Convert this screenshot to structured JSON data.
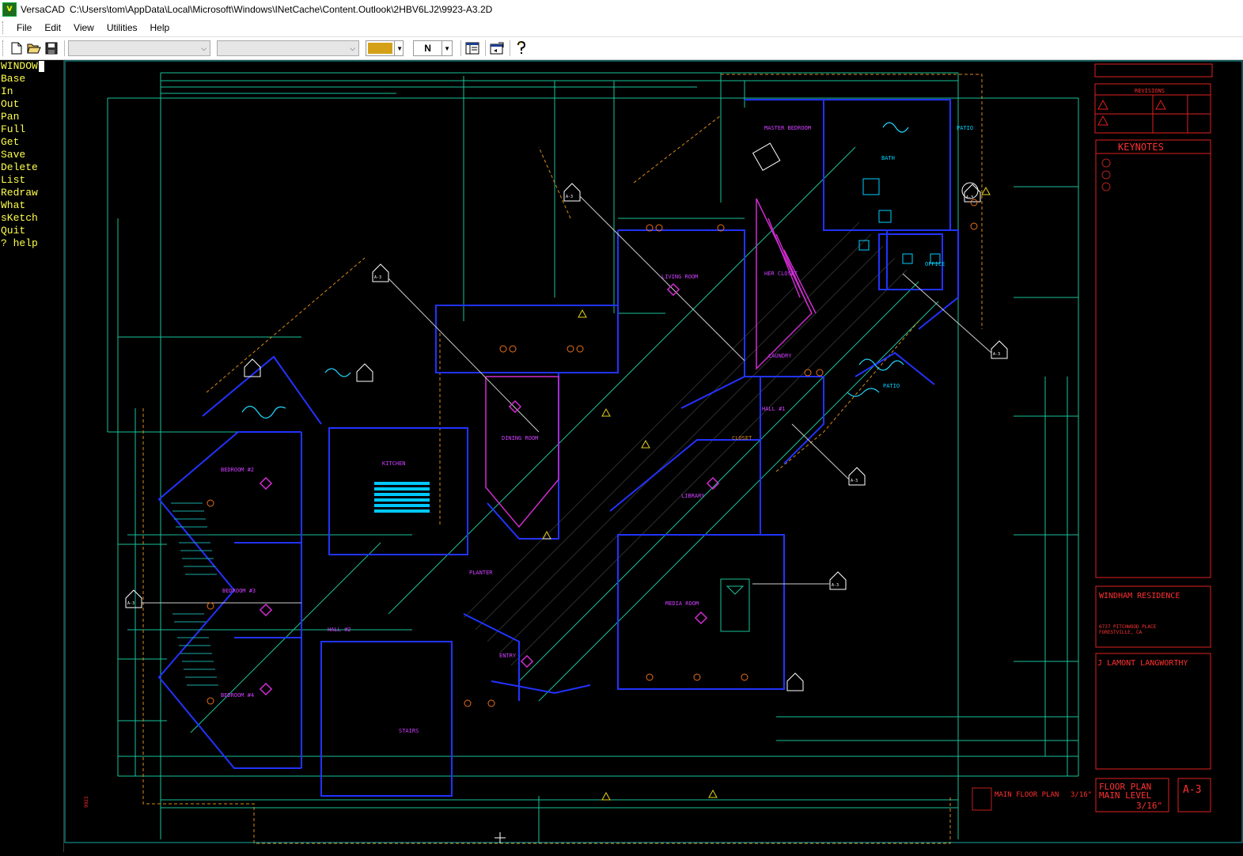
{
  "window": {
    "app_name": "VersaCAD",
    "file_path": "C:\\Users\\tom\\AppData\\Local\\Microsoft\\Windows\\INetCache\\Content.Outlook\\2HBV6LJ2\\9923-A3.2D"
  },
  "menu": [
    "File",
    "Edit",
    "View",
    "Utilities",
    "Help"
  ],
  "toolbar": {
    "layer_combo": "",
    "pen_combo": "",
    "color_value": "#d4a017",
    "line_style": "N"
  },
  "command_menu": {
    "header": "WINDOW",
    "items": [
      "Base",
      "In",
      "Out",
      "Pan",
      "Full",
      "Get",
      "Save",
      "Delete",
      "List",
      "Redraw",
      "What",
      "sKetch",
      "Quit",
      "? help"
    ]
  },
  "drawing": {
    "rooms": {
      "master_bedroom": "MASTER BEDROOM",
      "living_room": "LIVING ROOM",
      "her_closet": "HER CLOSET",
      "office": "OFFICE",
      "laundry": "LAUNDRY",
      "patio_right": "PATIO",
      "patio_top": "PATIO",
      "bath": "BATH",
      "kitchen": "KITCHEN",
      "dining_room": "DINING ROOM",
      "bedroom_2": "BEDROOM #2",
      "bedroom_3": "BEDROOM #3",
      "bedroom_4": "BEDROOM #4",
      "library": "LIBRARY",
      "media_room": "MEDIA ROOM",
      "entry": "ENTRY",
      "hall_1": "HALL #1",
      "hall_2": "HALL #2",
      "stairs": "STAIRS",
      "planter": "PLANTER",
      "closet": "CLOSET"
    },
    "section_markers": [
      "A-3",
      "A-3",
      "A-3",
      "A-3",
      "A-3",
      "A-3",
      "A-3"
    ]
  },
  "title_block": {
    "revisions_label": "REVISIONS",
    "keynotes_label": "KEYNOTES",
    "project_name": "WINDHAM RESIDENCE",
    "address_line1": "6737 PITCHWOOD PLACE",
    "address_line2": "FORESTVILLE, CA",
    "architect": "J LAMONT LANGWORTHY",
    "sheet_title_line1": "FLOOR PLAN",
    "sheet_title_line2": "MAIN LEVEL",
    "scale": "3/16\"",
    "sheet_number": "A-3",
    "plan_caption": "MAIN FLOOR PLAN",
    "plan_scale": "3/16\""
  }
}
